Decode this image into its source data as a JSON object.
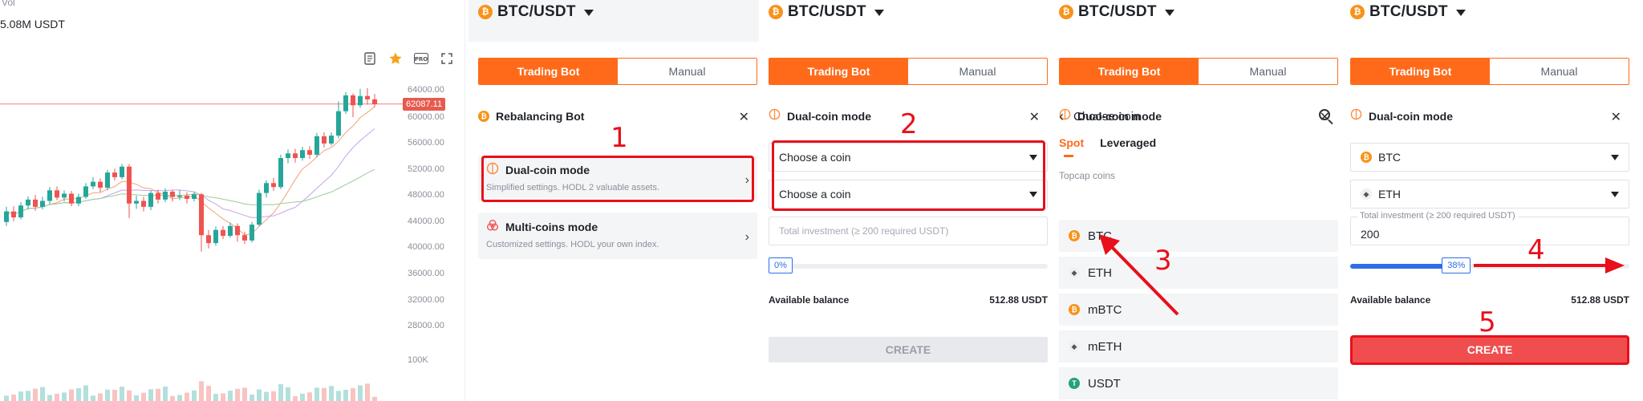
{
  "chart": {
    "vol_label": "Vol",
    "vol_value": "5.08M USDT",
    "last_price": "62087.11",
    "price_ticks": [
      "64000.00",
      "60000.00",
      "56000.00",
      "52000.00",
      "48000.00",
      "44000.00",
      "40000.00",
      "36000.00",
      "32000.00",
      "28000.00"
    ],
    "volume_tick": "100K",
    "tools": [
      "notes-icon",
      "star-icon",
      "pro-icon",
      "expand-icon"
    ],
    "tool_pro_label": "PRO",
    "candles": [
      {
        "o": 44200,
        "c": 45800,
        "h": 46500,
        "l": 43600
      },
      {
        "o": 45800,
        "c": 44900,
        "h": 46600,
        "l": 44300
      },
      {
        "o": 44900,
        "c": 46700,
        "h": 47200,
        "l": 44600
      },
      {
        "o": 46700,
        "c": 47600,
        "h": 48100,
        "l": 46100
      },
      {
        "o": 47600,
        "c": 46500,
        "h": 48300,
        "l": 45900
      },
      {
        "o": 46500,
        "c": 47400,
        "h": 48000,
        "l": 46100
      },
      {
        "o": 47400,
        "c": 49000,
        "h": 49500,
        "l": 46900
      },
      {
        "o": 49000,
        "c": 47900,
        "h": 49600,
        "l": 47500
      },
      {
        "o": 47900,
        "c": 48500,
        "h": 49000,
        "l": 47300
      },
      {
        "o": 48500,
        "c": 47000,
        "h": 48900,
        "l": 46600
      },
      {
        "o": 47000,
        "c": 48000,
        "h": 48500,
        "l": 46600
      },
      {
        "o": 48000,
        "c": 49600,
        "h": 50100,
        "l": 47700
      },
      {
        "o": 49600,
        "c": 50300,
        "h": 51000,
        "l": 49200
      },
      {
        "o": 50300,
        "c": 49400,
        "h": 50800,
        "l": 48700
      },
      {
        "o": 49400,
        "c": 51700,
        "h": 52100,
        "l": 49000
      },
      {
        "o": 51700,
        "c": 51000,
        "h": 52300,
        "l": 50500
      },
      {
        "o": 51000,
        "c": 52600,
        "h": 53000,
        "l": 50700
      },
      {
        "o": 52600,
        "c": 47000,
        "h": 53000,
        "l": 44800
      },
      {
        "o": 47000,
        "c": 47400,
        "h": 48200,
        "l": 46200
      },
      {
        "o": 47400,
        "c": 46500,
        "h": 48000,
        "l": 45800
      },
      {
        "o": 46500,
        "c": 48600,
        "h": 49000,
        "l": 46000
      },
      {
        "o": 48600,
        "c": 47600,
        "h": 49100,
        "l": 47000
      },
      {
        "o": 47600,
        "c": 48800,
        "h": 49300,
        "l": 47200
      },
      {
        "o": 48800,
        "c": 48000,
        "h": 49100,
        "l": 47300
      },
      {
        "o": 48000,
        "c": 48200,
        "h": 49000,
        "l": 47500
      },
      {
        "o": 48200,
        "c": 47700,
        "h": 48700,
        "l": 47000
      },
      {
        "o": 47700,
        "c": 48400,
        "h": 48800,
        "l": 47300
      },
      {
        "o": 48400,
        "c": 42200,
        "h": 48600,
        "l": 39700
      },
      {
        "o": 42200,
        "c": 41000,
        "h": 43000,
        "l": 40200
      },
      {
        "o": 41000,
        "c": 43000,
        "h": 43500,
        "l": 40600
      },
      {
        "o": 43000,
        "c": 42100,
        "h": 43600,
        "l": 41600
      },
      {
        "o": 42100,
        "c": 43600,
        "h": 44100,
        "l": 41800
      },
      {
        "o": 43600,
        "c": 42200,
        "h": 44000,
        "l": 41200
      },
      {
        "o": 42200,
        "c": 41400,
        "h": 42700,
        "l": 40900
      },
      {
        "o": 41400,
        "c": 43800,
        "h": 44200,
        "l": 41100
      },
      {
        "o": 43800,
        "c": 48600,
        "h": 49100,
        "l": 43500
      },
      {
        "o": 48600,
        "c": 50100,
        "h": 50500,
        "l": 47900
      },
      {
        "o": 50100,
        "c": 49500,
        "h": 50900,
        "l": 48900
      },
      {
        "o": 49500,
        "c": 53900,
        "h": 54400,
        "l": 49200
      },
      {
        "o": 53900,
        "c": 54600,
        "h": 55200,
        "l": 53100
      },
      {
        "o": 54600,
        "c": 53900,
        "h": 55300,
        "l": 53200
      },
      {
        "o": 53900,
        "c": 55100,
        "h": 55600,
        "l": 53500
      },
      {
        "o": 55100,
        "c": 54400,
        "h": 55700,
        "l": 53800
      },
      {
        "o": 54400,
        "c": 57200,
        "h": 57700,
        "l": 54000
      },
      {
        "o": 57200,
        "c": 56100,
        "h": 57800,
        "l": 55500
      },
      {
        "o": 56100,
        "c": 57300,
        "h": 57800,
        "l": 55800
      },
      {
        "o": 57300,
        "c": 61000,
        "h": 62500,
        "l": 56900
      },
      {
        "o": 61000,
        "c": 63400,
        "h": 63900,
        "l": 60600
      },
      {
        "o": 63400,
        "c": 61900,
        "h": 63700,
        "l": 60100
      },
      {
        "o": 61900,
        "c": 63300,
        "h": 64400,
        "l": 61500
      },
      {
        "o": 63300,
        "c": 62800,
        "h": 64500,
        "l": 62000
      },
      {
        "o": 62800,
        "c": 62087,
        "h": 63600,
        "l": 61600
      }
    ]
  },
  "panels": [
    {
      "pair": "BTC/USDT",
      "tab_active": "Trading Bot",
      "tab_inactive": "Manual",
      "mode_title": "Rebalancing Bot",
      "options": [
        {
          "title": "Dual-coin mode",
          "desc": "Simplified settings. HODL 2 valuable assets."
        },
        {
          "title": "Multi-coins mode",
          "desc": "Customized settings. HODL your own index."
        }
      ],
      "step": "1"
    },
    {
      "pair": "BTC/USDT",
      "tab_active": "Trading Bot",
      "tab_inactive": "Manual",
      "mode_title": "Dual-coin mode",
      "select1": "Choose a coin",
      "select2": "Choose a coin",
      "invest_placeholder": "Total investment (≥ 200 required USDT)",
      "slider_label": "0%",
      "slider_value": 0,
      "balance_label": "Available balance",
      "balance_value": "512.88 USDT",
      "create": "CREATE",
      "step": "2"
    },
    {
      "pair": "BTC/USDT",
      "tab_active": "Trading Bot",
      "tab_inactive": "Manual",
      "mode_title": "Dual-coin mode",
      "list_title": "Choose coin",
      "market_tabs": [
        "Spot",
        "Leveraged"
      ],
      "topcap": "Topcap coins",
      "coins": [
        {
          "symbol": "BTC",
          "icon": "btc",
          "glyph": "₿"
        },
        {
          "symbol": "ETH",
          "icon": "eth",
          "glyph": "◆"
        },
        {
          "symbol": "mBTC",
          "icon": "btc",
          "glyph": "₿"
        },
        {
          "symbol": "mETH",
          "icon": "eth",
          "glyph": "◆"
        },
        {
          "symbol": "USDT",
          "icon": "usdt",
          "glyph": "T"
        }
      ],
      "step": "3"
    },
    {
      "pair": "BTC/USDT",
      "tab_active": "Trading Bot",
      "tab_inactive": "Manual",
      "mode_title": "Dual-coin mode",
      "select1": "BTC",
      "select2": "ETH",
      "invest_label": "Total investment (≥ 200 required USDT)",
      "invest_value": "200",
      "slider_label": "38%",
      "slider_value": 0.38,
      "balance_label": "Available balance",
      "balance_value": "512.88 USDT",
      "create": "CREATE",
      "step_slider": "4",
      "step_create": "5"
    }
  ],
  "colors": {
    "accent": "#ff6a1a",
    "annotation": "#e8101a",
    "up": "#26a69a",
    "down": "#ef5350",
    "slider": "#2d6ee8"
  }
}
